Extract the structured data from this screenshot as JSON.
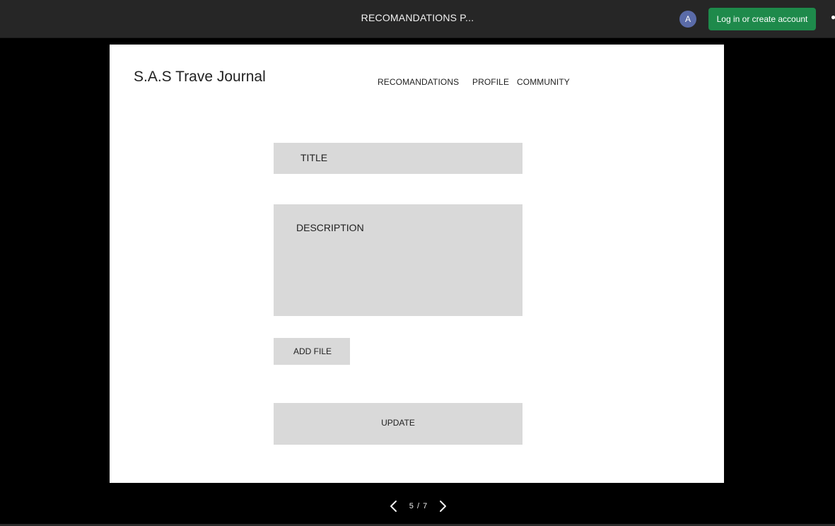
{
  "topbar": {
    "title": "RECOMANDATIONS P...",
    "avatar_initial": "A",
    "login_label": "Log in or create account",
    "login_color": "#1e8a4b",
    "avatar_color": "#5a6ba8"
  },
  "slide": {
    "brand": "S.A.S Trave Journal",
    "nav": {
      "recommendations": "RECOMANDATIONS",
      "profile": "PROFILE",
      "community": "COMMUNITY"
    },
    "form": {
      "title_label": "TITLE",
      "description_label": "DESCRIPTION",
      "add_file_label": "ADD FILE",
      "update_label": "UPDATE"
    },
    "field_color": "#d9d9d9"
  },
  "pager": {
    "current": 5,
    "total": 7,
    "label": "5 / 7",
    "prev_icon": "chevron-left-icon",
    "next_icon": "chevron-right-icon"
  }
}
